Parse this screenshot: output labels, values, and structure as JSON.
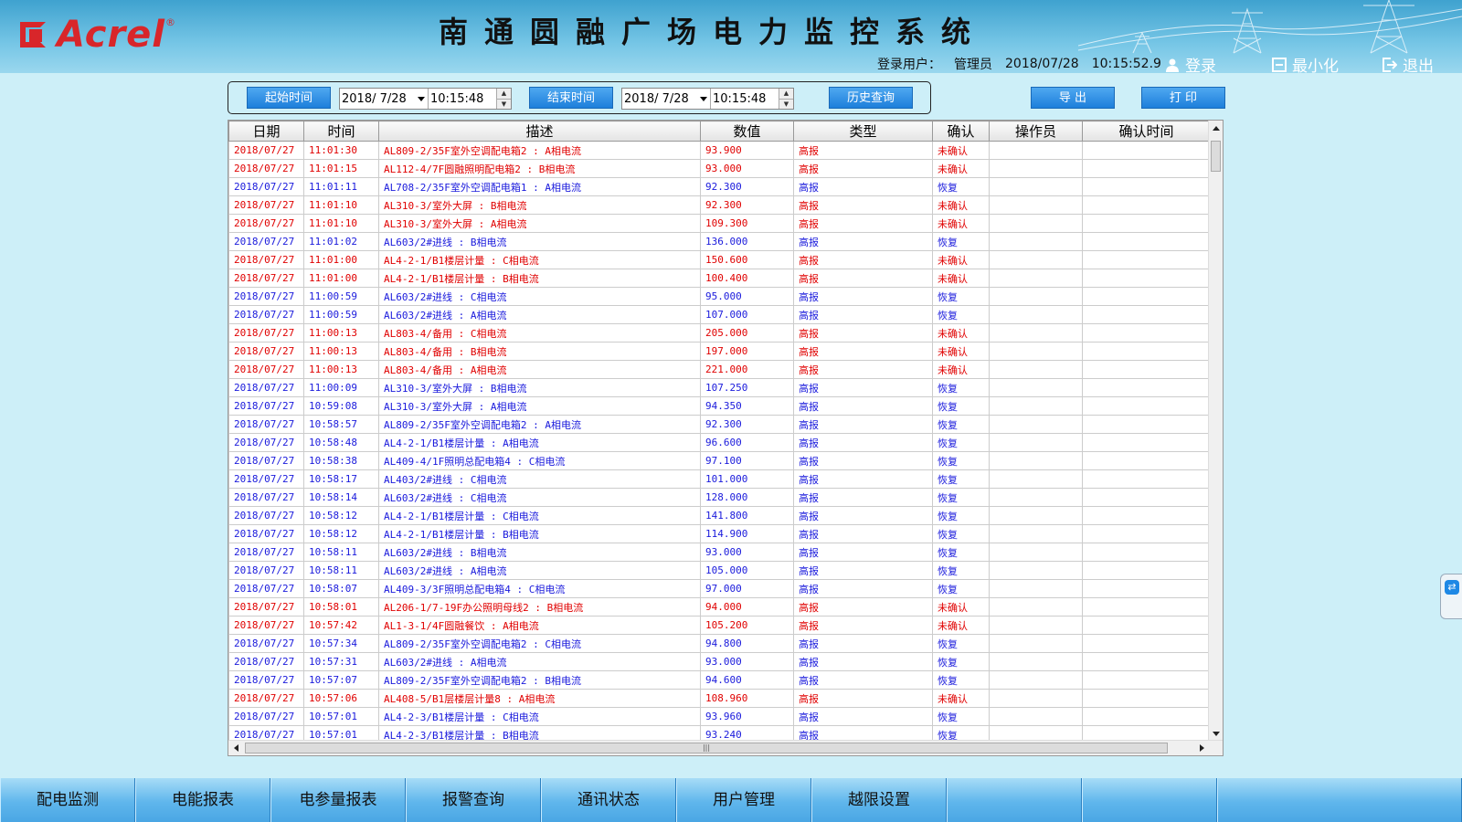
{
  "header": {
    "logo_text": "Acrel",
    "logo_reg": "®",
    "title": "南通圆融广场电力监控系统",
    "user_label": "登录用户：",
    "user_name": "管理员",
    "date": "2018/07/28",
    "time": "10:15:52.9",
    "login_label": "登录",
    "minimize_label": "最小化",
    "exit_label": "退出"
  },
  "toolbar": {
    "start_label": "起始时间",
    "start_date": "2018/ 7/28",
    "start_time": "10:15:48",
    "end_label": "结束时间",
    "end_date": "2018/ 7/28",
    "end_time": "10:15:48",
    "history_label": "历史查询",
    "export_label": "导 出",
    "print_label": "打 印"
  },
  "table": {
    "columns": [
      "日期",
      "时间",
      "描述",
      "数值",
      "类型",
      "确认",
      "操作员",
      "确认时间"
    ],
    "rows": [
      {
        "status": "red",
        "date": "2018/07/27",
        "time": "11:01:30",
        "desc": "AL809-2/35F室外空调配电箱2 : A相电流",
        "value": "93.900",
        "type": "高报",
        "confirm": "未确认",
        "operator": "",
        "confirm_time": ""
      },
      {
        "status": "red",
        "date": "2018/07/27",
        "time": "11:01:15",
        "desc": "AL112-4/7F圆融照明配电箱2 : B相电流",
        "value": "93.000",
        "type": "高报",
        "confirm": "未确认",
        "operator": "",
        "confirm_time": ""
      },
      {
        "status": "blue",
        "date": "2018/07/27",
        "time": "11:01:11",
        "desc": "AL708-2/35F室外空调配电箱1 : A相电流",
        "value": "92.300",
        "type": "高报",
        "confirm": "恢复",
        "operator": "",
        "confirm_time": ""
      },
      {
        "status": "red",
        "date": "2018/07/27",
        "time": "11:01:10",
        "desc": "AL310-3/室外大屏 : B相电流",
        "value": "92.300",
        "type": "高报",
        "confirm": "未确认",
        "operator": "",
        "confirm_time": ""
      },
      {
        "status": "red",
        "date": "2018/07/27",
        "time": "11:01:10",
        "desc": "AL310-3/室外大屏 : A相电流",
        "value": "109.300",
        "type": "高报",
        "confirm": "未确认",
        "operator": "",
        "confirm_time": ""
      },
      {
        "status": "blue",
        "date": "2018/07/27",
        "time": "11:01:02",
        "desc": "AL603/2#进线 : B相电流",
        "value": "136.000",
        "type": "高报",
        "confirm": "恢复",
        "operator": "",
        "confirm_time": ""
      },
      {
        "status": "red",
        "date": "2018/07/27",
        "time": "11:01:00",
        "desc": "AL4-2-1/B1楼层计量 : C相电流",
        "value": "150.600",
        "type": "高报",
        "confirm": "未确认",
        "operator": "",
        "confirm_time": ""
      },
      {
        "status": "red",
        "date": "2018/07/27",
        "time": "11:01:00",
        "desc": "AL4-2-1/B1楼层计量 : B相电流",
        "value": "100.400",
        "type": "高报",
        "confirm": "未确认",
        "operator": "",
        "confirm_time": ""
      },
      {
        "status": "blue",
        "date": "2018/07/27",
        "time": "11:00:59",
        "desc": "AL603/2#进线 : C相电流",
        "value": "95.000",
        "type": "高报",
        "confirm": "恢复",
        "operator": "",
        "confirm_time": ""
      },
      {
        "status": "blue",
        "date": "2018/07/27",
        "time": "11:00:59",
        "desc": "AL603/2#进线 : A相电流",
        "value": "107.000",
        "type": "高报",
        "confirm": "恢复",
        "operator": "",
        "confirm_time": ""
      },
      {
        "status": "red",
        "date": "2018/07/27",
        "time": "11:00:13",
        "desc": "AL803-4/备用 : C相电流",
        "value": "205.000",
        "type": "高报",
        "confirm": "未确认",
        "operator": "",
        "confirm_time": ""
      },
      {
        "status": "red",
        "date": "2018/07/27",
        "time": "11:00:13",
        "desc": "AL803-4/备用 : B相电流",
        "value": "197.000",
        "type": "高报",
        "confirm": "未确认",
        "operator": "",
        "confirm_time": ""
      },
      {
        "status": "red",
        "date": "2018/07/27",
        "time": "11:00:13",
        "desc": "AL803-4/备用 : A相电流",
        "value": "221.000",
        "type": "高报",
        "confirm": "未确认",
        "operator": "",
        "confirm_time": ""
      },
      {
        "status": "blue",
        "date": "2018/07/27",
        "time": "11:00:09",
        "desc": "AL310-3/室外大屏 : B相电流",
        "value": "107.250",
        "type": "高报",
        "confirm": "恢复",
        "operator": "",
        "confirm_time": ""
      },
      {
        "status": "blue",
        "date": "2018/07/27",
        "time": "10:59:08",
        "desc": "AL310-3/室外大屏 : A相电流",
        "value": "94.350",
        "type": "高报",
        "confirm": "恢复",
        "operator": "",
        "confirm_time": ""
      },
      {
        "status": "blue",
        "date": "2018/07/27",
        "time": "10:58:57",
        "desc": "AL809-2/35F室外空调配电箱2 : A相电流",
        "value": "92.300",
        "type": "高报",
        "confirm": "恢复",
        "operator": "",
        "confirm_time": ""
      },
      {
        "status": "blue",
        "date": "2018/07/27",
        "time": "10:58:48",
        "desc": "AL4-2-1/B1楼层计量 : A相电流",
        "value": "96.600",
        "type": "高报",
        "confirm": "恢复",
        "operator": "",
        "confirm_time": ""
      },
      {
        "status": "blue",
        "date": "2018/07/27",
        "time": "10:58:38",
        "desc": "AL409-4/1F照明总配电箱4 : C相电流",
        "value": "97.100",
        "type": "高报",
        "confirm": "恢复",
        "operator": "",
        "confirm_time": ""
      },
      {
        "status": "blue",
        "date": "2018/07/27",
        "time": "10:58:17",
        "desc": "AL403/2#进线 : C相电流",
        "value": "101.000",
        "type": "高报",
        "confirm": "恢复",
        "operator": "",
        "confirm_time": ""
      },
      {
        "status": "blue",
        "date": "2018/07/27",
        "time": "10:58:14",
        "desc": "AL603/2#进线 : C相电流",
        "value": "128.000",
        "type": "高报",
        "confirm": "恢复",
        "operator": "",
        "confirm_time": ""
      },
      {
        "status": "blue",
        "date": "2018/07/27",
        "time": "10:58:12",
        "desc": "AL4-2-1/B1楼层计量 : C相电流",
        "value": "141.800",
        "type": "高报",
        "confirm": "恢复",
        "operator": "",
        "confirm_time": ""
      },
      {
        "status": "blue",
        "date": "2018/07/27",
        "time": "10:58:12",
        "desc": "AL4-2-1/B1楼层计量 : B相电流",
        "value": "114.900",
        "type": "高报",
        "confirm": "恢复",
        "operator": "",
        "confirm_time": ""
      },
      {
        "status": "blue",
        "date": "2018/07/27",
        "time": "10:58:11",
        "desc": "AL603/2#进线 : B相电流",
        "value": "93.000",
        "type": "高报",
        "confirm": "恢复",
        "operator": "",
        "confirm_time": ""
      },
      {
        "status": "blue",
        "date": "2018/07/27",
        "time": "10:58:11",
        "desc": "AL603/2#进线 : A相电流",
        "value": "105.000",
        "type": "高报",
        "confirm": "恢复",
        "operator": "",
        "confirm_time": ""
      },
      {
        "status": "blue",
        "date": "2018/07/27",
        "time": "10:58:07",
        "desc": "AL409-3/3F照明总配电箱4 : C相电流",
        "value": "97.000",
        "type": "高报",
        "confirm": "恢复",
        "operator": "",
        "confirm_time": ""
      },
      {
        "status": "red",
        "date": "2018/07/27",
        "time": "10:58:01",
        "desc": "AL206-1/7-19F办公照明母线2 : B相电流",
        "value": "94.000",
        "type": "高报",
        "confirm": "未确认",
        "operator": "",
        "confirm_time": ""
      },
      {
        "status": "red",
        "date": "2018/07/27",
        "time": "10:57:42",
        "desc": "AL1-3-1/4F圆融餐饮 : A相电流",
        "value": "105.200",
        "type": "高报",
        "confirm": "未确认",
        "operator": "",
        "confirm_time": ""
      },
      {
        "status": "blue",
        "date": "2018/07/27",
        "time": "10:57:34",
        "desc": "AL809-2/35F室外空调配电箱2 : C相电流",
        "value": "94.800",
        "type": "高报",
        "confirm": "恢复",
        "operator": "",
        "confirm_time": ""
      },
      {
        "status": "blue",
        "date": "2018/07/27",
        "time": "10:57:31",
        "desc": "AL603/2#进线 : A相电流",
        "value": "93.000",
        "type": "高报",
        "confirm": "恢复",
        "operator": "",
        "confirm_time": ""
      },
      {
        "status": "blue",
        "date": "2018/07/27",
        "time": "10:57:07",
        "desc": "AL809-2/35F室外空调配电箱2 : B相电流",
        "value": "94.600",
        "type": "高报",
        "confirm": "恢复",
        "operator": "",
        "confirm_time": ""
      },
      {
        "status": "red",
        "date": "2018/07/27",
        "time": "10:57:06",
        "desc": "AL408-5/B1层楼层计量8 : A相电流",
        "value": "108.960",
        "type": "高报",
        "confirm": "未确认",
        "operator": "",
        "confirm_time": ""
      },
      {
        "status": "blue",
        "date": "2018/07/27",
        "time": "10:57:01",
        "desc": "AL4-2-3/B1楼层计量 : C相电流",
        "value": "93.960",
        "type": "高报",
        "confirm": "恢复",
        "operator": "",
        "confirm_time": ""
      },
      {
        "status": "blue",
        "date": "2018/07/27",
        "time": "10:57:01",
        "desc": "AL4-2-3/B1楼层计量 : B相电流",
        "value": "93.240",
        "type": "高报",
        "confirm": "恢复",
        "operator": "",
        "confirm_time": ""
      }
    ]
  },
  "bottom_nav": {
    "items": [
      "配电监测",
      "电能报表",
      "电参量报表",
      "报警查询",
      "通讯状态",
      "用户管理",
      "越限设置"
    ]
  },
  "colors": {
    "alarm_unconfirmed": "#e00000",
    "alarm_recovered": "#1a1adc",
    "button_blue": "#1d7fdb",
    "brand_red": "#d8262a"
  },
  "icons": {
    "login": "user-icon",
    "minimize": "minimize-icon",
    "exit": "exit-icon",
    "side_widget": "teamviewer-icon"
  }
}
